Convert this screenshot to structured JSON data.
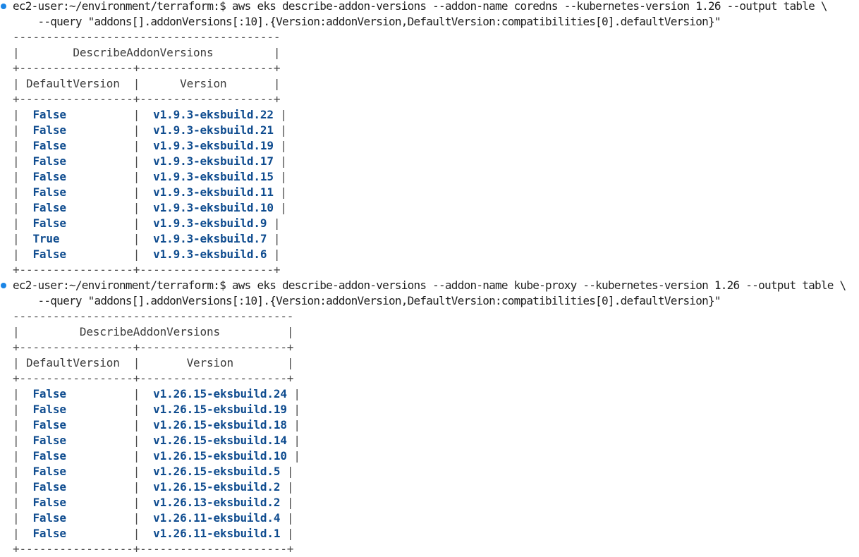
{
  "colors": {
    "prompt_dot": "#1a85e6",
    "value_text": "#0f4c8f",
    "plain_text": "#1f1f1f"
  },
  "blocks": [
    {
      "prompt": "ec2-user:~/environment/terraform:$",
      "command": "aws eks describe-addon-versions --addon-name coredns --kubernetes-version 1.26 --output table \\",
      "continuation": "--query \"addons[].addonVersions[:10].{Version:addonVersion,DefaultVersion:compatibilities[0].defaultVersion}\"",
      "table": {
        "title": "DescribeAddonVersions",
        "headers": [
          "DefaultVersion",
          "Version"
        ],
        "rows": [
          [
            "False",
            "v1.9.3-eksbuild.22"
          ],
          [
            "False",
            "v1.9.3-eksbuild.21"
          ],
          [
            "False",
            "v1.9.3-eksbuild.19"
          ],
          [
            "False",
            "v1.9.3-eksbuild.17"
          ],
          [
            "False",
            "v1.9.3-eksbuild.15"
          ],
          [
            "False",
            "v1.9.3-eksbuild.11"
          ],
          [
            "False",
            "v1.9.3-eksbuild.10"
          ],
          [
            "False",
            "v1.9.3-eksbuild.9"
          ],
          [
            "True",
            "v1.9.3-eksbuild.7"
          ],
          [
            "False",
            "v1.9.3-eksbuild.6"
          ]
        ]
      }
    },
    {
      "prompt": "ec2-user:~/environment/terraform:$",
      "command": "aws eks describe-addon-versions --addon-name kube-proxy --kubernetes-version 1.26 --output table \\",
      "continuation": "--query \"addons[].addonVersions[:10].{Version:addonVersion,DefaultVersion:compatibilities[0].defaultVersion}\"",
      "table": {
        "title": "DescribeAddonVersions",
        "headers": [
          "DefaultVersion",
          "Version"
        ],
        "rows": [
          [
            "False",
            "v1.26.15-eksbuild.24"
          ],
          [
            "False",
            "v1.26.15-eksbuild.19"
          ],
          [
            "False",
            "v1.26.15-eksbuild.18"
          ],
          [
            "False",
            "v1.26.15-eksbuild.14"
          ],
          [
            "False",
            "v1.26.15-eksbuild.10"
          ],
          [
            "False",
            "v1.26.15-eksbuild.5"
          ],
          [
            "False",
            "v1.26.15-eksbuild.2"
          ],
          [
            "False",
            "v1.26.13-eksbuild.2"
          ],
          [
            "False",
            "v1.26.11-eksbuild.4"
          ],
          [
            "False",
            "v1.26.11-eksbuild.1"
          ]
        ]
      }
    }
  ]
}
